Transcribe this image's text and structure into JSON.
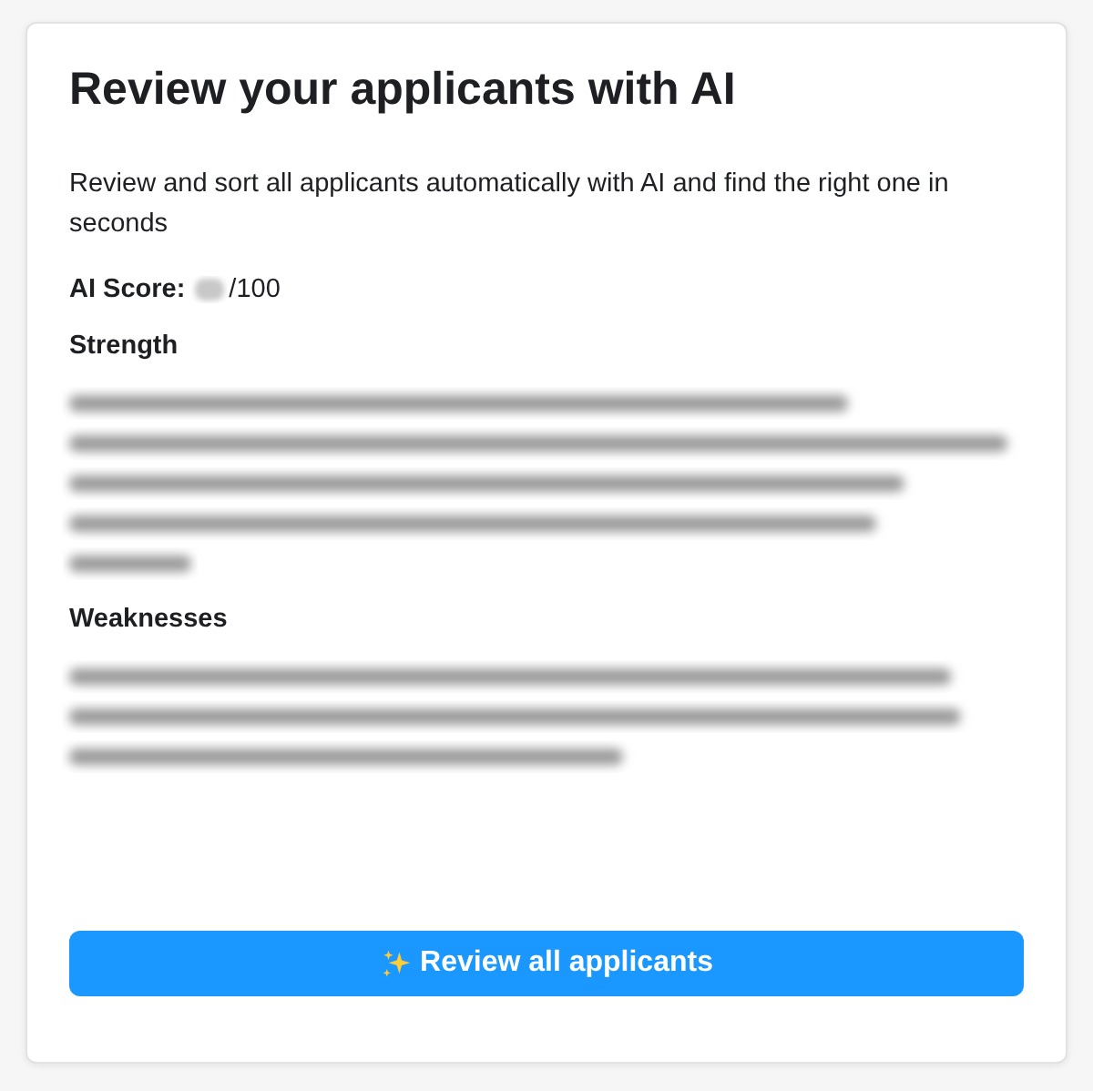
{
  "title": "Review your applicants with AI",
  "description": "Review and sort all applicants automatically with AI and find the right one in seconds",
  "score": {
    "label": "AI Score:",
    "value": {
      "kind": "blurred"
    },
    "suffix": "/100"
  },
  "sections": [
    {
      "heading": "Strength",
      "body": {
        "kind": "blurred"
      }
    },
    {
      "heading": "Weaknesses",
      "body": {
        "kind": "blurred"
      }
    }
  ],
  "button": {
    "label": "Review all applicants"
  }
}
